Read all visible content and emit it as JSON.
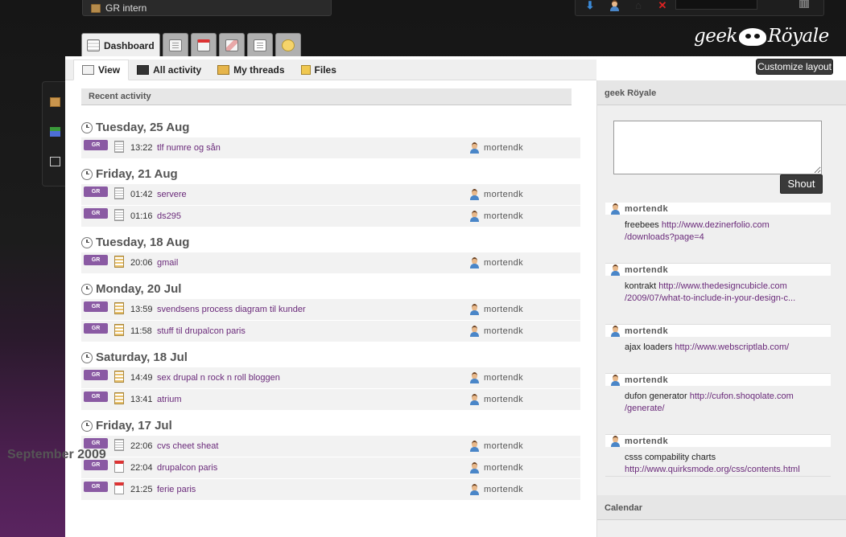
{
  "space_switcher": {
    "label": "GR intern"
  },
  "main_tabs": [
    {
      "label": "Dashboard",
      "icon": "dashboard-icon"
    },
    {
      "label": "",
      "icon": "notebook-icon"
    },
    {
      "label": "",
      "icon": "calendar-icon"
    },
    {
      "label": "",
      "icon": "pencil-icon"
    },
    {
      "label": "",
      "icon": "document-icon"
    },
    {
      "label": "",
      "icon": "chat-icon"
    }
  ],
  "customize_layout": "Customize layout",
  "sub_tabs": [
    {
      "label": "View"
    },
    {
      "label": "All activity"
    },
    {
      "label": "My threads"
    },
    {
      "label": "Files"
    }
  ],
  "recent_activity": {
    "header": "Recent activity",
    "days": [
      {
        "heading": "Tuesday, 25 Aug",
        "items": [
          {
            "badge": "GR",
            "type": "doc",
            "time": "13:22",
            "title": "tlf numre og sån",
            "user": "mortendk"
          }
        ]
      },
      {
        "heading": "Friday, 21 Aug",
        "items": [
          {
            "badge": "GR",
            "type": "doc",
            "time": "01:42",
            "title": "servere",
            "user": "mortendk"
          },
          {
            "badge": "GR",
            "type": "doc",
            "time": "01:16",
            "title": "ds295",
            "user": "mortendk"
          }
        ]
      },
      {
        "heading": "Tuesday, 18 Aug",
        "items": [
          {
            "badge": "GR",
            "type": "notebook",
            "time": "20:06",
            "title": "gmail",
            "user": "mortendk"
          }
        ]
      },
      {
        "heading": "Monday, 20 Jul",
        "items": [
          {
            "badge": "GR",
            "type": "notebook",
            "time": "13:59",
            "title": "svendsens process diagram til kunder",
            "user": "mortendk"
          },
          {
            "badge": "GR",
            "type": "notebook",
            "time": "11:58",
            "title": "stuff til drupalcon paris",
            "user": "mortendk"
          }
        ]
      },
      {
        "heading": "Saturday, 18 Jul",
        "items": [
          {
            "badge": "GR",
            "type": "notebook",
            "time": "14:49",
            "title": "sex drupal n rock n roll bloggen",
            "user": "mortendk"
          },
          {
            "badge": "GR",
            "type": "notebook",
            "time": "13:41",
            "title": "atrium",
            "user": "mortendk"
          }
        ]
      },
      {
        "heading": "Friday, 17 Jul",
        "items": [
          {
            "badge": "GR",
            "type": "doc",
            "time": "22:06",
            "title": "cvs cheet sheat",
            "user": "mortendk"
          },
          {
            "badge": "GR",
            "type": "cal",
            "time": "22:04",
            "title": "drupalcon paris",
            "user": "mortendk"
          },
          {
            "badge": "GR",
            "type": "cal",
            "time": "21:25",
            "title": "ferie paris",
            "user": "mortendk"
          }
        ]
      }
    ]
  },
  "shoutbox": {
    "title": "geek Röyale",
    "button": "Shout",
    "shouts": [
      {
        "user": "mortendk",
        "text": "freebees ",
        "link": "http://www.dezinerfolio.com",
        "link2": "/downloads?page=4"
      },
      {
        "user": "mortendk",
        "text": "kontrakt ",
        "link": "http://www.thedesigncubicle.com",
        "link2": "/2009/07/what-to-include-in-your-design-c..."
      },
      {
        "user": "mortendk",
        "text": "ajax loaders ",
        "link": "http://www.webscriptlab.com/",
        "link2": ""
      },
      {
        "user": "mortendk",
        "text": "dufon generator ",
        "link": "http://cufon.shoqolate.com",
        "link2": "/generate/"
      },
      {
        "user": "mortendk",
        "text": "csss compability charts",
        "link": "",
        "link2": "http://www.quirksmode.org/css/contents.html"
      }
    ]
  },
  "calendar": {
    "title": "Calendar",
    "month": "September 2009"
  },
  "logo": {
    "left": "geek",
    "right": "Röyale"
  }
}
